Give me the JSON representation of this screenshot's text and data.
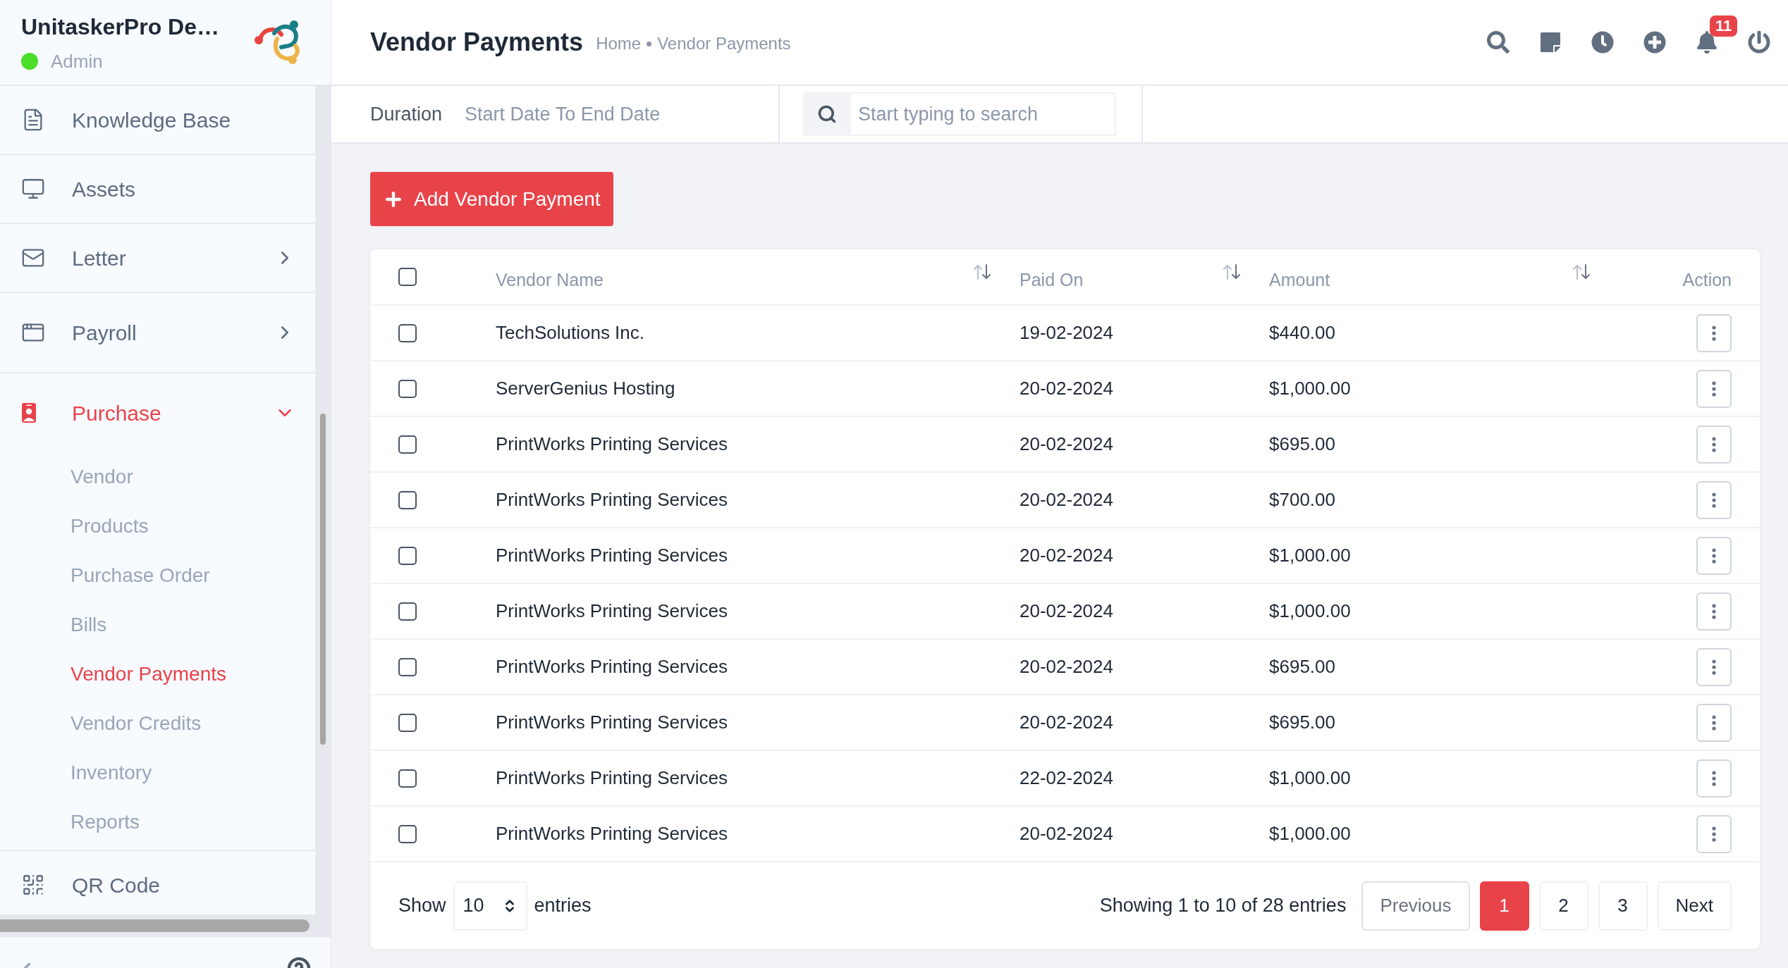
{
  "app": {
    "name": "UnitaskerPro De…",
    "role": "Admin",
    "online": true
  },
  "sidebar": {
    "items": [
      {
        "label": "Knowledge Base",
        "kind": "link",
        "selected": false
      },
      {
        "label": "Assets",
        "kind": "link",
        "selected": false
      },
      {
        "label": "Letter",
        "kind": "group",
        "selected": false,
        "expanded": false
      },
      {
        "label": "Payroll",
        "kind": "group",
        "selected": false,
        "expanded": false
      },
      {
        "label": "Purchase",
        "kind": "group",
        "selected": true,
        "expanded": true,
        "children": [
          {
            "label": "Vendor",
            "selected": false
          },
          {
            "label": "Products",
            "selected": false
          },
          {
            "label": "Purchase Order",
            "selected": false
          },
          {
            "label": "Bills",
            "selected": false
          },
          {
            "label": "Vendor Payments",
            "selected": true
          },
          {
            "label": "Vendor Credits",
            "selected": false
          },
          {
            "label": "Inventory",
            "selected": false
          },
          {
            "label": "Reports",
            "selected": false
          }
        ]
      },
      {
        "label": "QR Code",
        "kind": "link",
        "selected": false
      }
    ]
  },
  "header": {
    "title": "Vendor Payments",
    "breadcrumb": [
      "Home",
      "Vendor Payments"
    ],
    "notification_count": "11"
  },
  "filters": {
    "duration_label": "Duration",
    "date_placeholder": "Start Date To End Date",
    "search_placeholder": "Start typing to search"
  },
  "add_button": "Add Vendor Payment",
  "table": {
    "select_all_checked": false,
    "columns": [
      {
        "label": "Vendor Name",
        "sortable": true
      },
      {
        "label": "Paid On",
        "sortable": true
      },
      {
        "label": "Amount",
        "sortable": true
      },
      {
        "label": "Action",
        "sortable": false
      }
    ],
    "rows": [
      {
        "vendor": "TechSolutions Inc.",
        "paid_on": "19-02-2024",
        "amount": "$440.00",
        "checked": false
      },
      {
        "vendor": "ServerGenius Hosting",
        "paid_on": "20-02-2024",
        "amount": "$1,000.00",
        "checked": false
      },
      {
        "vendor": "PrintWorks Printing Services",
        "paid_on": "20-02-2024",
        "amount": "$695.00",
        "checked": false
      },
      {
        "vendor": "PrintWorks Printing Services",
        "paid_on": "20-02-2024",
        "amount": "$700.00",
        "checked": false
      },
      {
        "vendor": "PrintWorks Printing Services",
        "paid_on": "20-02-2024",
        "amount": "$1,000.00",
        "checked": false
      },
      {
        "vendor": "PrintWorks Printing Services",
        "paid_on": "20-02-2024",
        "amount": "$1,000.00",
        "checked": false
      },
      {
        "vendor": "PrintWorks Printing Services",
        "paid_on": "20-02-2024",
        "amount": "$695.00",
        "checked": false
      },
      {
        "vendor": "PrintWorks Printing Services",
        "paid_on": "20-02-2024",
        "amount": "$695.00",
        "checked": false
      },
      {
        "vendor": "PrintWorks Printing Services",
        "paid_on": "22-02-2024",
        "amount": "$1,000.00",
        "checked": false
      },
      {
        "vendor": "PrintWorks Printing Services",
        "paid_on": "20-02-2024",
        "amount": "$1,000.00",
        "checked": false
      }
    ]
  },
  "pagination": {
    "show_label": "Show",
    "page_size": "10",
    "entries_label": "entries",
    "summary": "Showing 1 to 10 of 28 entries",
    "previous": "Previous",
    "pages": [
      {
        "label": "1",
        "selected": true
      },
      {
        "label": "2",
        "selected": false
      },
      {
        "label": "3",
        "selected": false
      }
    ],
    "next": "Next"
  }
}
